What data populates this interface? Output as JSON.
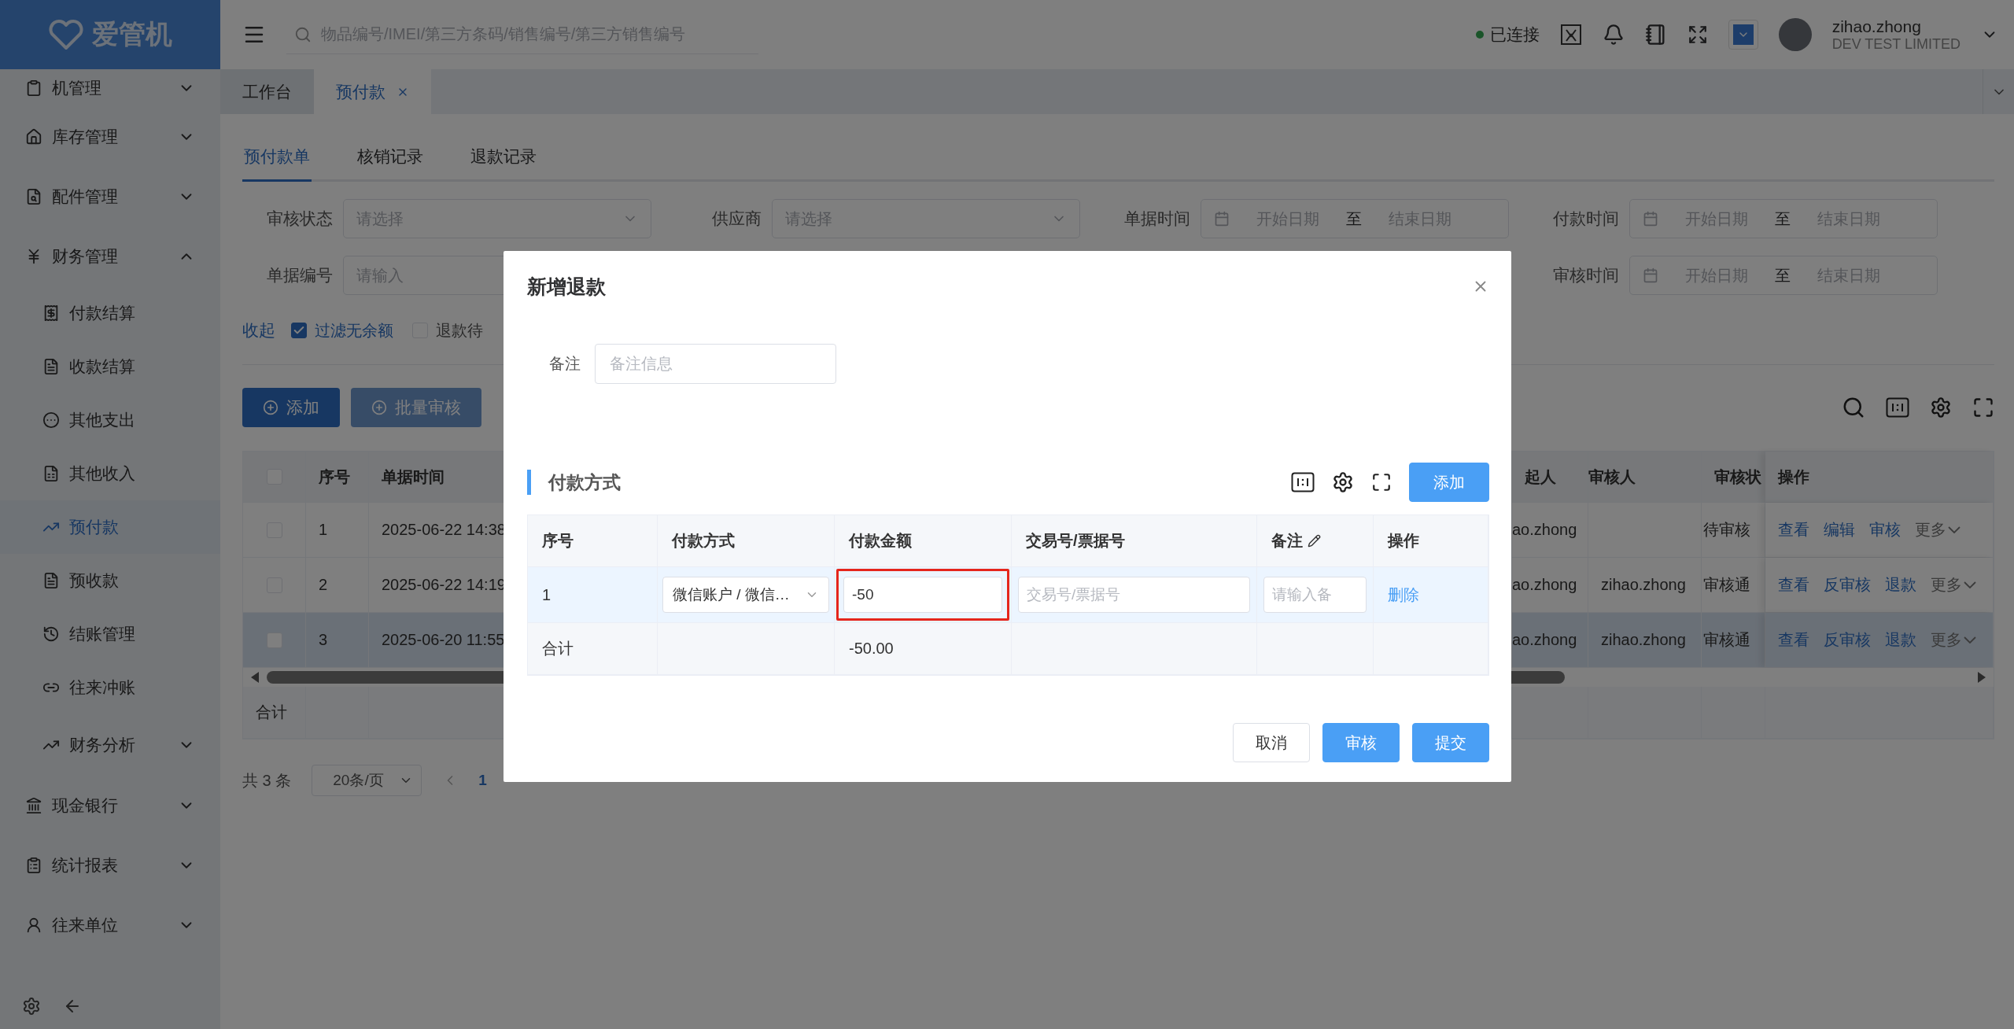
{
  "logo": {
    "text": "爱管机"
  },
  "header": {
    "search_placeholder": "物品编号/IMEI/第三方条码/销售编号/第三方销售编号",
    "status": {
      "label": "已连接",
      "connected": true
    },
    "user": {
      "name": "zihao.zhong",
      "company": "DEV TEST LIMITED"
    }
  },
  "sidebar": {
    "items": [
      {
        "label": "机管理",
        "kind": "group",
        "expanded": false,
        "selected": false
      },
      {
        "label": "库存管理",
        "kind": "group",
        "expanded": false,
        "selected": false
      },
      {
        "label": "配件管理",
        "kind": "group",
        "expanded": false,
        "selected": false
      },
      {
        "label": "财务管理",
        "kind": "group",
        "expanded": true,
        "selected": false,
        "children": [
          {
            "label": "付款结算",
            "kind": "link",
            "selected": false
          },
          {
            "label": "收款结算",
            "kind": "link",
            "selected": false
          },
          {
            "label": "其他支出",
            "kind": "link",
            "selected": false
          },
          {
            "label": "其他收入",
            "kind": "link",
            "selected": false
          },
          {
            "label": "预付款",
            "kind": "link",
            "selected": true
          },
          {
            "label": "预收款",
            "kind": "link",
            "selected": false
          },
          {
            "label": "结账管理",
            "kind": "link",
            "selected": false
          },
          {
            "label": "往来冲账",
            "kind": "link",
            "selected": false
          },
          {
            "label": "财务分析",
            "kind": "group",
            "expanded": false,
            "selected": false
          }
        ]
      },
      {
        "label": "现金银行",
        "kind": "group",
        "expanded": false,
        "selected": false
      },
      {
        "label": "统计报表",
        "kind": "group",
        "expanded": false,
        "selected": false
      },
      {
        "label": "往来单位",
        "kind": "group",
        "expanded": false,
        "selected": false
      }
    ]
  },
  "page_tabs": [
    {
      "label": "工作台",
      "selected": false,
      "closable": false
    },
    {
      "label": "预付款",
      "selected": true,
      "closable": true
    }
  ],
  "sub_tabs": [
    {
      "label": "预付款单",
      "selected": true
    },
    {
      "label": "核销记录",
      "selected": false
    },
    {
      "label": "退款记录",
      "selected": false
    }
  ],
  "filters": [
    [
      {
        "label": "审核状态",
        "kind": "select",
        "placeholder": "请选择"
      },
      {
        "label": "供应商",
        "kind": "select",
        "placeholder": "请选择"
      },
      {
        "label": "单据时间",
        "kind": "date_range",
        "start_placeholder": "开始日期",
        "separator": "至",
        "end_placeholder": "结束日期"
      },
      {
        "label": "付款时间",
        "kind": "date_range",
        "start_placeholder": "开始日期",
        "separator": "至",
        "end_placeholder": "结束日期"
      }
    ],
    [
      {
        "label": "单据编号",
        "kind": "text",
        "placeholder": "请输入"
      },
      {
        "label": "审核时间",
        "kind": "date_range",
        "start_placeholder": "开始日期",
        "separator": "至",
        "end_placeholder": "结束日期"
      }
    ]
  ],
  "collapse_link": "收起",
  "options": [
    {
      "label": "过滤无余额",
      "checked": true
    },
    {
      "label": "退款待",
      "checked": false
    }
  ],
  "toolbar": [
    {
      "label": "添加",
      "disabled": false
    },
    {
      "label": "批量审核",
      "disabled": true
    }
  ],
  "table": {
    "header_checked": false,
    "columns": [
      "序号",
      "单据时间",
      "起人",
      "审核人",
      "审核状",
      "操作"
    ],
    "rows": [
      {
        "checked": false,
        "hovered": false,
        "index": "1",
        "time": "2025-06-22 14:38",
        "creator": "ao.zhong",
        "status": "待审核",
        "actions": [
          {
            "label": "查看",
            "kind": "link"
          },
          {
            "label": "编辑",
            "kind": "link"
          },
          {
            "label": "审核",
            "kind": "link"
          },
          {
            "label": "更多",
            "kind": "menu"
          }
        ]
      },
      {
        "checked": false,
        "hovered": false,
        "index": "2",
        "time": "2025-06-22 14:19",
        "creator": "ao.zhong",
        "auditor": "zihao.zhong",
        "status": "审核通",
        "actions": [
          {
            "label": "查看",
            "kind": "link"
          },
          {
            "label": "反审核",
            "kind": "link"
          },
          {
            "label": "退款",
            "kind": "link"
          },
          {
            "label": "更多",
            "kind": "menu"
          }
        ]
      },
      {
        "checked": false,
        "hovered": true,
        "index": "3",
        "time": "2025-06-20 11:55",
        "creator": "ao.zhong",
        "auditor": "zihao.zhong",
        "status": "审核通",
        "actions": [
          {
            "label": "查看",
            "kind": "link"
          },
          {
            "label": "反审核",
            "kind": "link"
          },
          {
            "label": "退款",
            "kind": "link"
          },
          {
            "label": "更多",
            "kind": "menu"
          }
        ]
      }
    ],
    "summary_label": "合计"
  },
  "pagination": {
    "total": "共 3 条",
    "page_size": "20条/页",
    "pages": [
      {
        "label": "1",
        "selected": true
      }
    ]
  },
  "modal": {
    "title": "新增退款",
    "remark": {
      "label": "备注",
      "placeholder": "备注信息"
    },
    "section": "付款方式",
    "add_button": "添加",
    "columns": [
      {
        "label": "序号",
        "editable": false
      },
      {
        "label": "付款方式",
        "editable": false
      },
      {
        "label": "付款金额",
        "editable": false
      },
      {
        "label": "交易号/票据号",
        "editable": false
      },
      {
        "label": "备注",
        "editable": true
      },
      {
        "label": "操作",
        "editable": false
      }
    ],
    "rows": [
      {
        "index": "1",
        "method": "微信账户 / 微信…",
        "amount": "-50",
        "amount_highlighted": true,
        "ref_placeholder": "交易号/票据号",
        "note_placeholder": "请输入备",
        "action": "删除"
      }
    ],
    "total": {
      "label": "合计",
      "amount": "-50.00"
    },
    "buttons": [
      {
        "label": "取消",
        "kind": "default"
      },
      {
        "label": "审核",
        "kind": "primary"
      },
      {
        "label": "提交",
        "kind": "primary"
      }
    ]
  }
}
